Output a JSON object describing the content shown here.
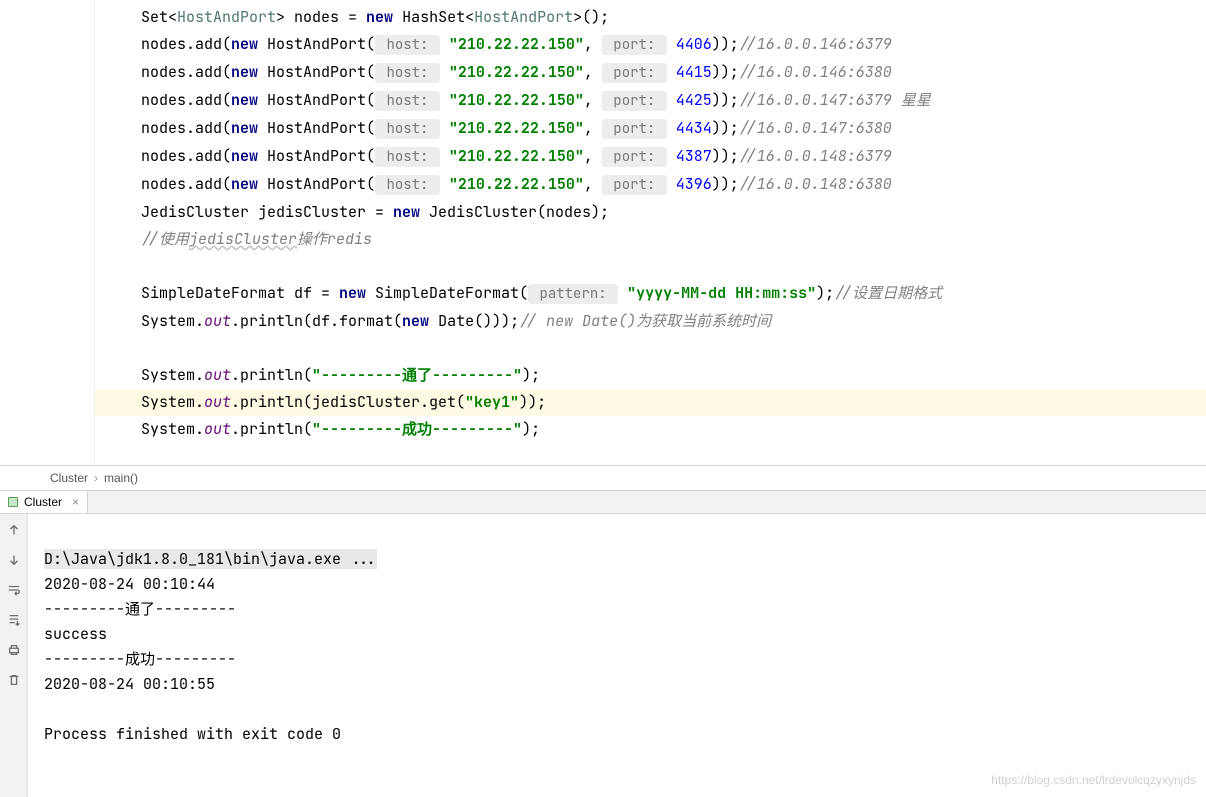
{
  "code": {
    "line1": {
      "pre": "    Set<",
      "tp1": "HostAndPort",
      "mid1": "> nodes = ",
      "kw_new": "new",
      "mid2": " HashSet<",
      "tp2": "HostAndPort",
      "post": ">();"
    },
    "add_lines": [
      {
        "ip": "\"210.22.22.150\"",
        "port": "4406",
        "cmt": "//16.0.0.146:6379"
      },
      {
        "ip": "\"210.22.22.150\"",
        "port": "4415",
        "cmt": "//16.0.0.146:6380"
      },
      {
        "ip": "\"210.22.22.150\"",
        "port": "4425",
        "cmt": "//16.0.0.147:6379 星星"
      },
      {
        "ip": "\"210.22.22.150\"",
        "port": "4434",
        "cmt": "//16.0.0.147:6380"
      },
      {
        "ip": "\"210.22.22.150\"",
        "port": "4387",
        "cmt": "//16.0.0.148:6379"
      },
      {
        "ip": "\"210.22.22.150\"",
        "port": "4396",
        "cmt": "//16.0.0.148:6380"
      }
    ],
    "add_prefix": "    nodes.add(",
    "kw_new": "new",
    "add_class": " HostAndPort(",
    "hint_host": " host: ",
    "add_comma": ", ",
    "hint_port": " port: ",
    "add_close": "));",
    "jc_line": {
      "pre": "    JedisCluster jedisCluster = ",
      "kw": "new",
      "post": " JedisCluster(nodes);"
    },
    "cmt_jc": "    //使用jedisCluster操作redis",
    "jc_wavy": "jedisCluster",
    "sdf": {
      "pre": "    SimpleDateFormat df = ",
      "kw": "new",
      "mid": " SimpleDateFormat(",
      "hint": " pattern: ",
      "str": "\"yyyy-MM-dd HH:mm:ss\"",
      "close": ");",
      "cmt": "//设置日期格式"
    },
    "sout_date": {
      "pre": "    System.",
      "out": "out",
      "mid": ".println(df.format(",
      "kw": "new",
      "post": " Date()));",
      "cmt": "// new Date()为获取当前系统时间"
    },
    "sout_tong": {
      "pre": "    System.",
      "out": "out",
      "mid": ".println(",
      "str": "\"---------通了---------\"",
      "close": ");"
    },
    "sout_get": {
      "pre": "    System.",
      "out": "out",
      "mid": ".println(jedisCluster.get(",
      "str": "\"key1\"",
      "close": "));"
    },
    "sout_cg": {
      "pre": "    System.",
      "out": "out",
      "mid": ".println(",
      "str": "\"---------成功---------\"",
      "close": ");"
    }
  },
  "breadcrumb": {
    "item1": "Cluster",
    "item2": "main()"
  },
  "run_tab": {
    "label": "Cluster"
  },
  "console": {
    "cmd": "D:\\Java\\jdk1.8.0_181\\bin\\java.exe ...",
    "line2": "2020-08-24 00:10:44",
    "line3": "---------通了---------",
    "line4": "success",
    "line5": "---------成功---------",
    "line6": "2020-08-24 00:10:55",
    "line7": "",
    "line8": "Process finished with exit code 0"
  },
  "watermark": "https://blog.csdn.net/lrdevolcqzyxynjds"
}
